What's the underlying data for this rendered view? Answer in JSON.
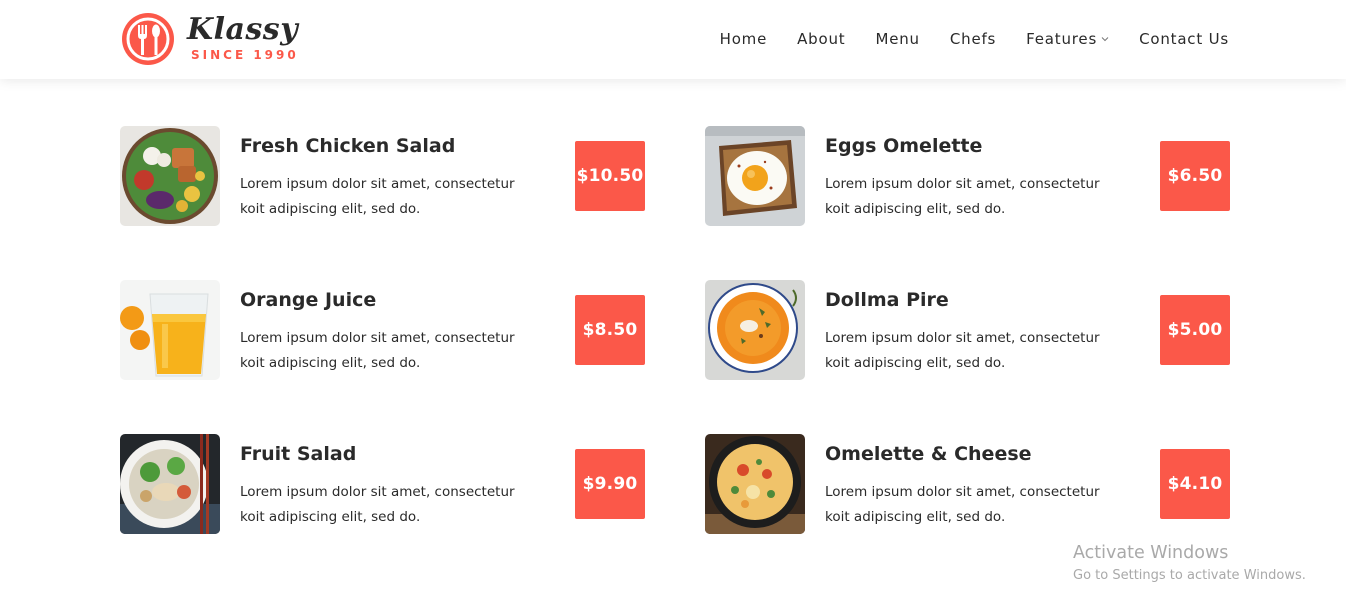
{
  "header": {
    "logo_text": "Klassy",
    "logo_sub": "SINCE 1990",
    "nav": [
      {
        "label": "Home",
        "name": "nav-home"
      },
      {
        "label": "About",
        "name": "nav-about"
      },
      {
        "label": "Menu",
        "name": "nav-menu"
      },
      {
        "label": "Chefs",
        "name": "nav-chefs"
      },
      {
        "label": "Features",
        "name": "nav-features",
        "dropdown": true
      },
      {
        "label": "Contact Us",
        "name": "nav-contact-us"
      }
    ]
  },
  "menu": {
    "items": [
      {
        "title": "Fresh Chicken Salad",
        "desc": "Lorem ipsum dolor sit amet, consectetur koit adipiscing elit, sed do.",
        "price": "$10.50",
        "image": "chicken-salad-photo"
      },
      {
        "title": "Eggs Omelette",
        "desc": "Lorem ipsum dolor sit amet, consectetur koit adipiscing elit, sed do.",
        "price": "$6.50",
        "image": "eggs-omelette-photo"
      },
      {
        "title": "Orange Juice",
        "desc": "Lorem ipsum dolor sit amet, consectetur koit adipiscing elit, sed do.",
        "price": "$8.50",
        "image": "orange-juice-photo"
      },
      {
        "title": "Dollma Pire",
        "desc": "Lorem ipsum dolor sit amet, consectetur koit adipiscing elit, sed do.",
        "price": "$5.00",
        "image": "dollma-pire-photo"
      },
      {
        "title": "Fruit Salad",
        "desc": "Lorem ipsum dolor sit amet, consectetur koit adipiscing elit, sed do.",
        "price": "$9.90",
        "image": "fruit-salad-photo"
      },
      {
        "title": "Omelette & Cheese",
        "desc": "Lorem ipsum dolor sit amet, consectetur koit adipiscing elit, sed do.",
        "price": "$4.10",
        "image": "omelette-cheese-photo"
      }
    ]
  },
  "watermark": {
    "title": "Activate Windows",
    "subtitle": "Go to Settings to activate Windows."
  },
  "colors": {
    "accent": "#fb5849",
    "text": "#2a2a2a",
    "watermark": "#a9a9a9"
  }
}
